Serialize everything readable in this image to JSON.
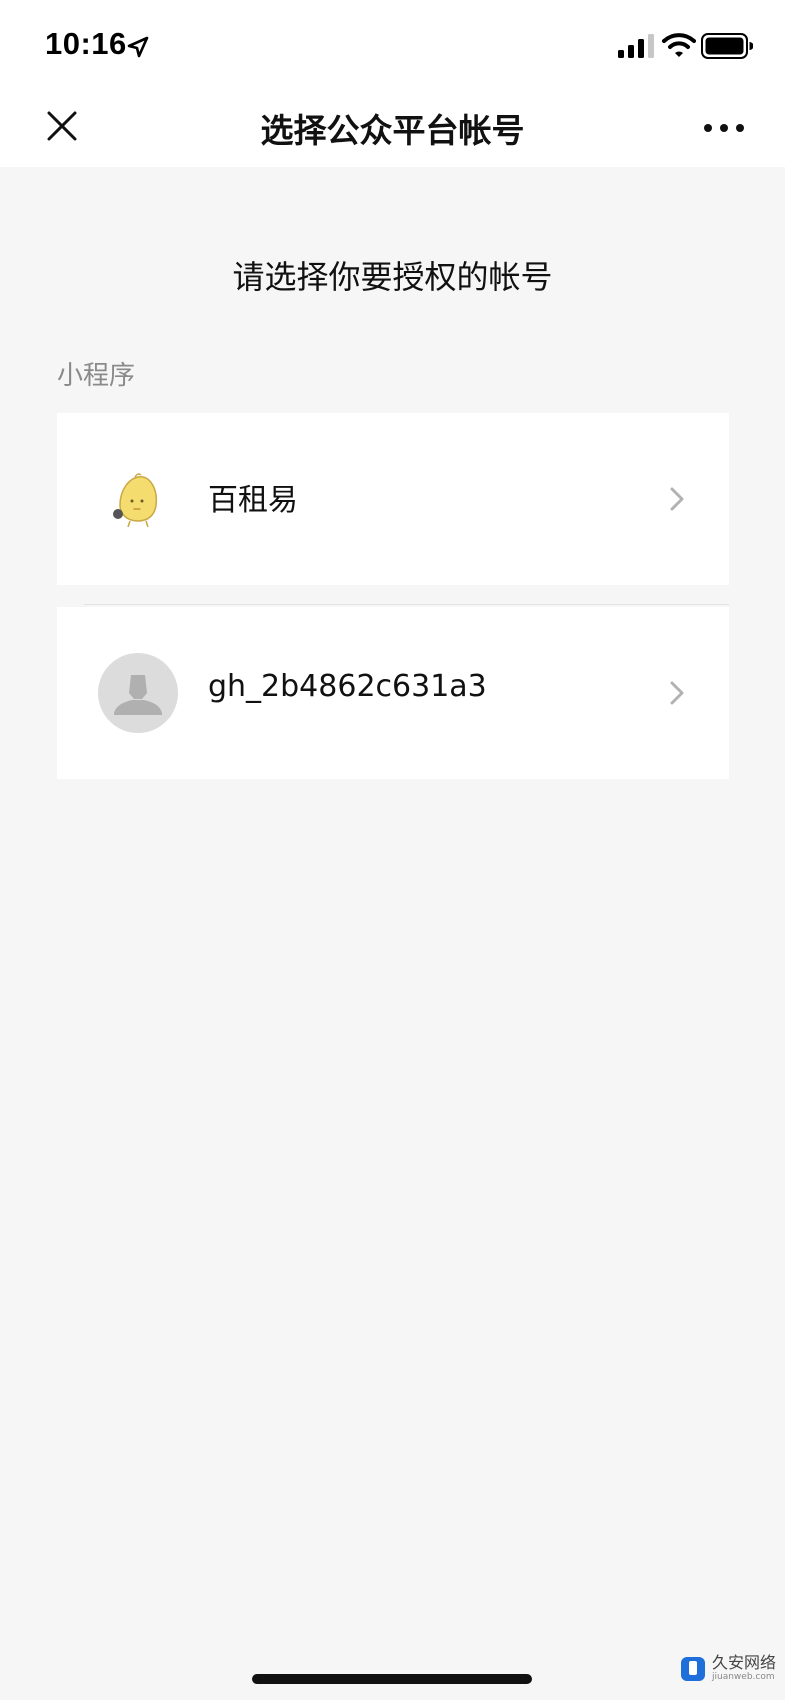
{
  "status_bar": {
    "time": "10:16",
    "icons": [
      "location-icon",
      "signal-icon",
      "wifi-icon",
      "battery-icon"
    ]
  },
  "nav": {
    "title": "选择公众平台帐号",
    "close_icon": "close-icon",
    "more_icon": "more-icon"
  },
  "page": {
    "heading": "请选择你要授权的帐号",
    "section_label": "小程序"
  },
  "accounts": [
    {
      "name": "百租易",
      "avatar": "mascot-avatar"
    },
    {
      "name": "gh_2b4862c631a3",
      "avatar": "default-user-avatar"
    }
  ],
  "watermark": {
    "text": "久安网络",
    "sub": "jiuanweb.com"
  },
  "colors": {
    "background": "#f6f6f6",
    "card": "#ffffff",
    "muted_text": "#8a8a8a",
    "default_avatar": "#dcdcdc",
    "mascot_yellow": "#f4dc6e"
  }
}
